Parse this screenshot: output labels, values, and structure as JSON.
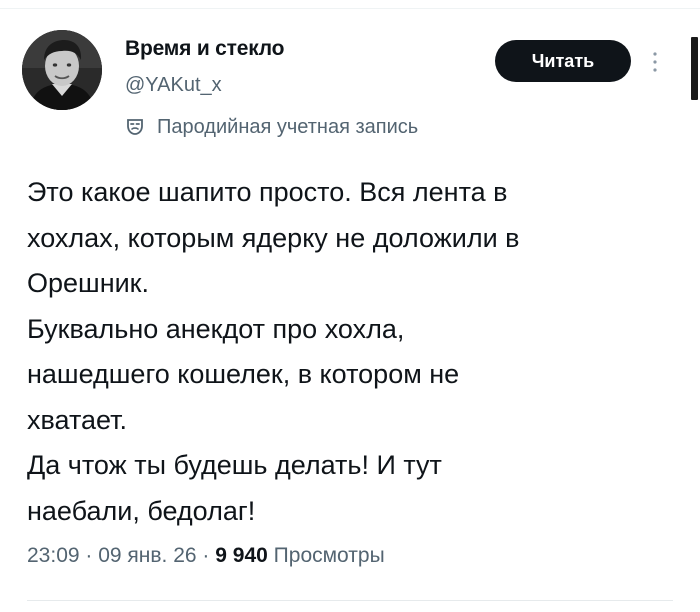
{
  "author": {
    "name": "Время и стекло",
    "handle": "@YAKut_x",
    "label": "Пародийная учетная запись"
  },
  "header": {
    "read_button_label": "Читать"
  },
  "tweet": {
    "lines": [
      "Это какое шапито просто. Вся лента в",
      "хохлах, которым ядерку не доложили в",
      "Орешник.",
      "Буквально анекдот про хохла,",
      "нашедшего кошелек, в котором не",
      "хватает.",
      "Да чтож ты будешь делать! И тут",
      "наебали, бедолаг!"
    ]
  },
  "meta": {
    "time": "23:09",
    "separator": " · ",
    "date": "09 янв. 26",
    "views_count": "9 940",
    "views_label": "Просмотры"
  },
  "icons": {
    "avatar": "avatar-photo",
    "more": "more-vertical-icon",
    "parody": "theater-mask-icon"
  }
}
